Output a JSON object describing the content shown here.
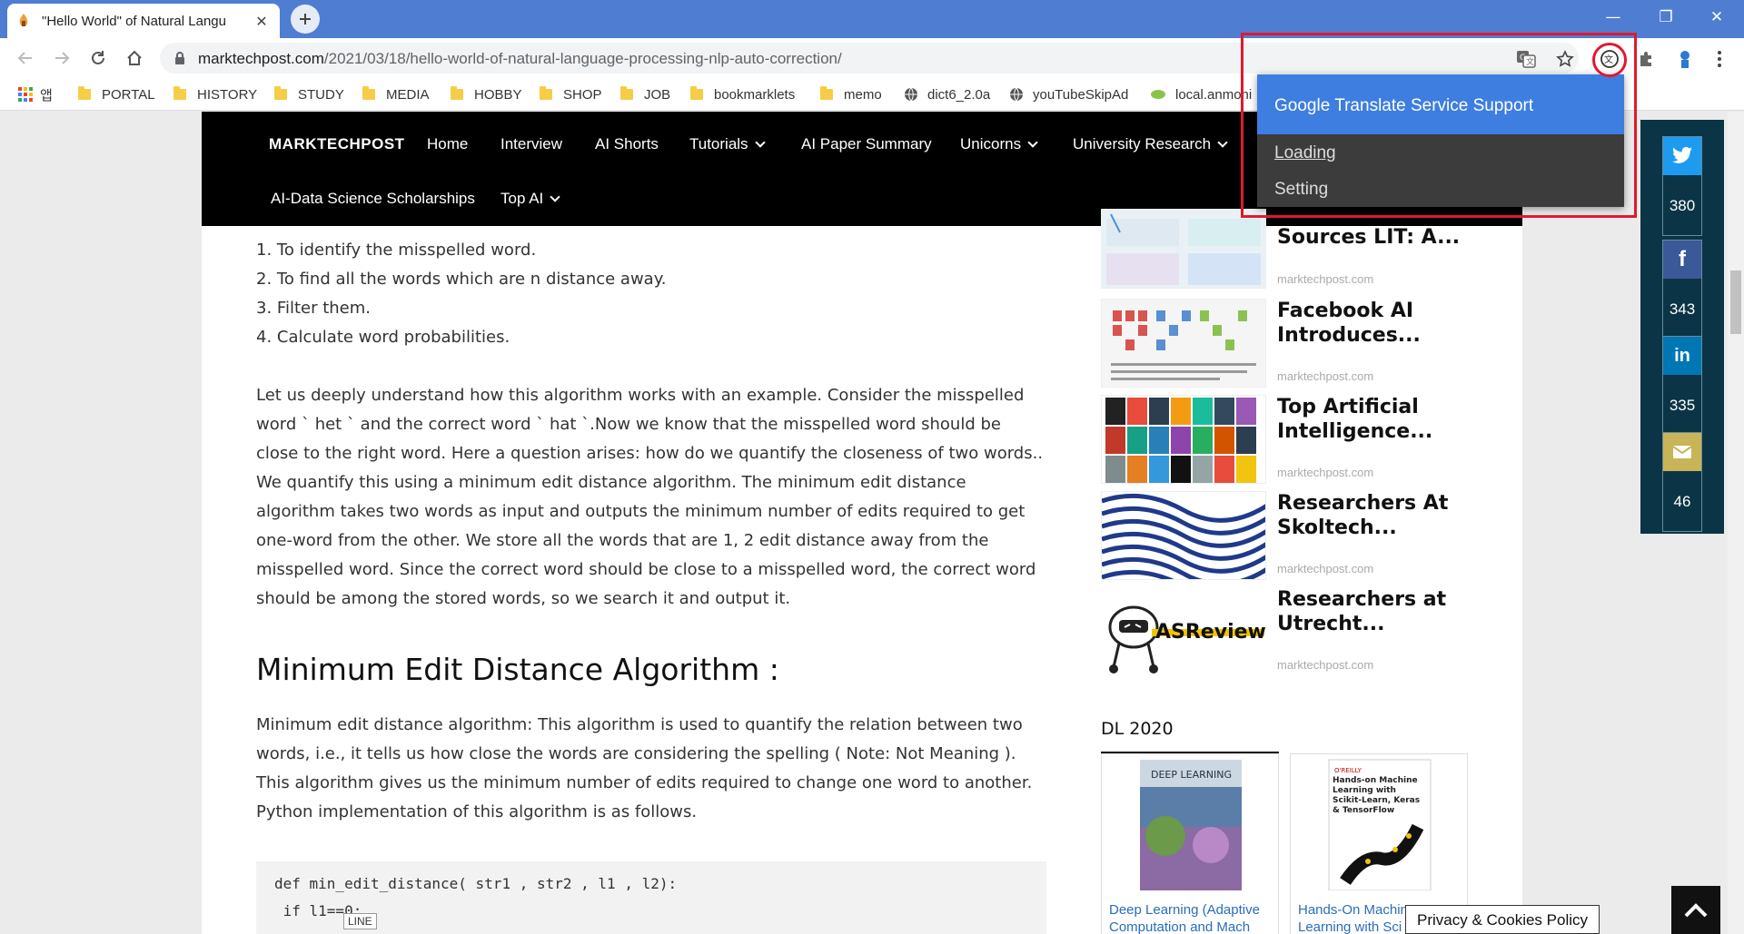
{
  "browser": {
    "tab_title": "\"Hello World\" of Natural Langu",
    "tab_close": "✕",
    "new_tab": "+",
    "url_host": "marktechpost.com",
    "url_path": "/2021/03/18/hello-world-of-natural-language-processing-nlp-auto-correction/",
    "window_controls": [
      "—",
      "❐",
      "✕"
    ]
  },
  "bookmarks": {
    "apps_label": "앱",
    "items": [
      "PORTAL",
      "HISTORY",
      "STUDY",
      "MEDIA",
      "HOBBY",
      "SHOP",
      "JOB",
      "bookmarklets",
      "memo",
      "dict6_2.0a",
      "youTubeSkipAd",
      "local.anmoni"
    ]
  },
  "site_nav": {
    "logo": "MARKTECHPOST",
    "items": [
      "Home",
      "Interview",
      "AI Shorts",
      "Tutorials",
      "AI Paper Summary",
      "Unicorns",
      "University Research",
      "AI-Data Science Scholarships",
      "Top AI"
    ]
  },
  "article": {
    "steps": [
      "1. To identify the misspelled word.",
      "2. To find all the words which are n distance away.",
      "3. Filter them.",
      "4. Calculate word probabilities."
    ],
    "paragraph1": "Let us deeply understand how this algorithm works with an example. Consider the misspelled word ` het ` and the correct word ` hat `.Now we know that the misspelled word should be close to the right word. Here a question arises: how do we quantify the closeness of two words.. We quantify this using a minimum edit distance algorithm. The minimum edit distance algorithm takes two words as input and outputs the minimum number of edits required to get one-word from the other. We store all the words that are 1, 2 edit distance away from the misspelled word. Since the correct word should be close to a misspelled word, the correct word should be among the stored words, so we search it and output it.",
    "heading": "Minimum Edit Distance Algorithm :",
    "paragraph2": "Minimum edit distance algorithm: This algorithm is used to quantify the relation between two words, i.e., it tells us how close the words are considering the spelling ( Note: Not Meaning ). This algorithm gives us the minimum number of edits required to change one word to another. Python implementation of this algorithm is as follows.",
    "code_line1": "def min_edit_distance( str1 , str2 , l1 , l2):",
    "code_line2": " if l1==0:",
    "tooltip": "LINE"
  },
  "sidebar": {
    "items": [
      {
        "title": "Sources LIT: A...",
        "source": "marktechpost.com"
      },
      {
        "title": "Facebook AI Introduces...",
        "source": "marktechpost.com"
      },
      {
        "title": "Top Artificial Intelligence...",
        "source": "marktechpost.com"
      },
      {
        "title": "Researchers At Skoltech...",
        "source": "marktechpost.com"
      },
      {
        "title": "Researchers at Utrecht...",
        "source": "marktechpost.com"
      }
    ],
    "asreview_logo_text": "ASReview",
    "dl_heading": "DL 2020",
    "books": [
      {
        "cover_title": "DEEP LEARNING",
        "caption": "Deep Learning (Adaptive Computation and Mach"
      },
      {
        "cover_publisher": "O'REILLY",
        "cover_title": "Hands-on Machine Learning with Scikit-Learn, Keras & TensorFlow",
        "caption": "Hands-On Machine Learning with Sci"
      }
    ]
  },
  "share": {
    "twitter_count": "380",
    "facebook_count": "343",
    "linkedin_count": "335",
    "email_count": "46",
    "colors": {
      "twitter": "#1d9bf0",
      "facebook": "#3b5998",
      "linkedin": "#0077b5",
      "email": "#c9b458"
    }
  },
  "extension_popup": {
    "title": "Google Translate Service Support",
    "loading": "Loading",
    "setting": "Setting"
  },
  "footer": {
    "privacy": "Privacy & Cookies Policy"
  }
}
